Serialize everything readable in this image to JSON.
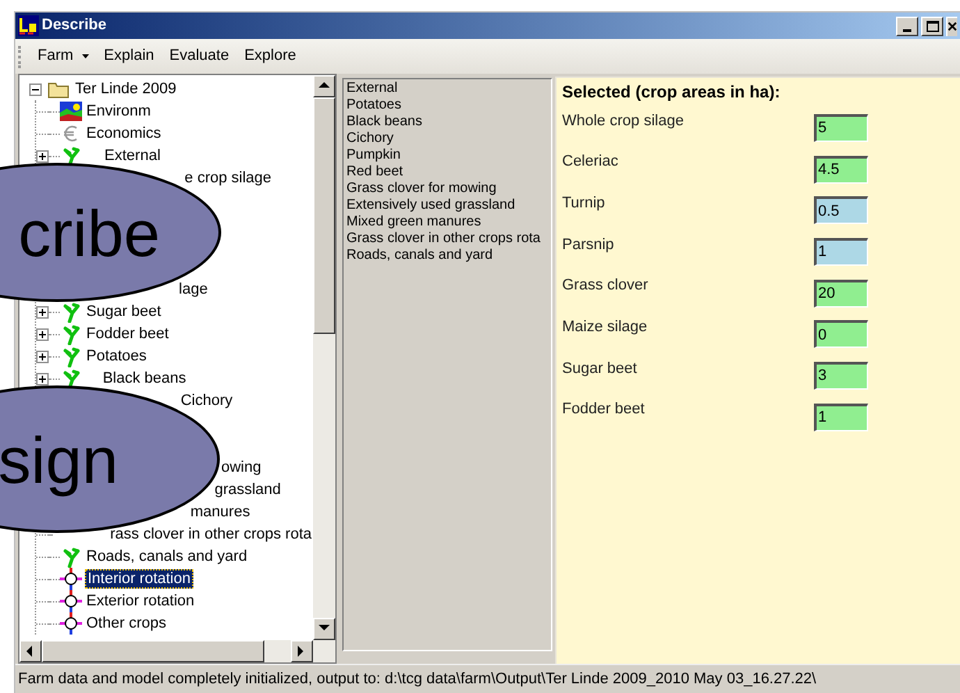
{
  "window": {
    "title": "Describe"
  },
  "menu": [
    {
      "label": "Farm",
      "dropdown": true
    },
    {
      "label": "Explain",
      "dropdown": false
    },
    {
      "label": "Evaluate",
      "dropdown": false
    },
    {
      "label": "Explore",
      "dropdown": false
    }
  ],
  "tree": {
    "label": "Ter Linde 2009",
    "expanded": true,
    "selected": false,
    "children": [
      {
        "label": "Environm",
        "kind": "environment",
        "expandable": false,
        "selected": false
      },
      {
        "label": "Economics",
        "kind": "economics",
        "expandable": false,
        "selected": false
      },
      {
        "label": "External",
        "kind": "crop",
        "expandable": true,
        "selected": false
      },
      {
        "label": "e crop silage",
        "selected": false
      },
      {
        "label": "lage",
        "selected": false
      },
      {
        "label": "Sugar beet",
        "kind": "crop",
        "expandable": true,
        "selected": false
      },
      {
        "label": "Fodder beet",
        "kind": "crop",
        "expandable": true,
        "selected": false
      },
      {
        "label": "Potatoes",
        "kind": "crop",
        "expandable": true,
        "selected": false
      },
      {
        "label": "Black beans",
        "kind": "crop",
        "expandable": true,
        "selected": false
      },
      {
        "label": "Cichory",
        "selected": false
      },
      {
        "label": "owing",
        "selected": false
      },
      {
        "label": "grassland",
        "selected": false
      },
      {
        "label": "manures",
        "selected": false
      },
      {
        "label": "rass clover in other crops rota",
        "selected": false
      },
      {
        "label": "Roads, canals and yard",
        "kind": "crop",
        "expandable": false,
        "selected": false
      },
      {
        "label": "Interior rotation",
        "kind": "rotation",
        "expandable": false,
        "selected": true
      },
      {
        "label": "Exterior rotation",
        "kind": "rotation",
        "expandable": false,
        "selected": false
      },
      {
        "label": "Other crops",
        "kind": "rotation",
        "expandable": false,
        "selected": false
      }
    ]
  },
  "overlay_labels": [
    "cribe",
    "sign"
  ],
  "crop_list": [
    "External",
    "Potatoes",
    "Black beans",
    "Cichory",
    "Pumpkin",
    "Red beet",
    "Grass clover for mowing",
    "Extensively used grassland",
    "Mixed green manures",
    "Grass clover in other crops rota",
    "Roads, canals and yard"
  ],
  "selected_panel": {
    "title": "Selected (crop areas in ha):",
    "fields": [
      {
        "label": "Whole crop silage",
        "value": "5",
        "color": "#90ee90"
      },
      {
        "label": "Celeriac",
        "value": "4.5",
        "color": "#90ee90"
      },
      {
        "label": "Turnip",
        "value": "0.5",
        "color": "#add8e6"
      },
      {
        "label": "Parsnip",
        "value": "1",
        "color": "#add8e6"
      },
      {
        "label": "Grass clover",
        "value": "20",
        "color": "#90ee90"
      },
      {
        "label": "Maize silage",
        "value": "0",
        "color": "#90ee90"
      },
      {
        "label": "Sugar beet",
        "value": "3",
        "color": "#90ee90"
      },
      {
        "label": "Fodder beet",
        "value": "1",
        "color": "#90ee90"
      }
    ]
  },
  "status_bar": "Farm data and model completely initialized, output to: d:\\tcg data\\farm\\Output\\Ter Linde 2009_2010 May 03_16.27.22\\"
}
